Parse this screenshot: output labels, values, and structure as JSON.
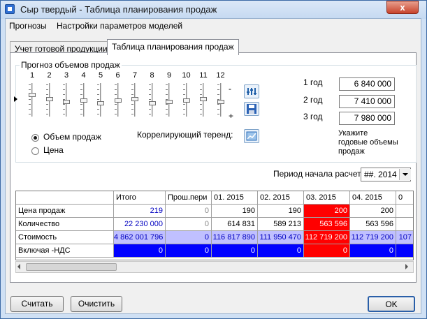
{
  "window": {
    "title": "Сыр твердый - Таблица планирования продаж",
    "close_glyph": "x"
  },
  "menu": [
    "Прогнозы",
    "Настройки параметров моделей"
  ],
  "tabs": [
    {
      "label": "Учет готовой продукции",
      "active": false
    },
    {
      "label": "Таблица планирования продаж",
      "active": true
    }
  ],
  "forecast": {
    "group_title": "Прогноз объемов продаж",
    "months": [
      "1",
      "2",
      "3",
      "4",
      "5",
      "6",
      "7",
      "8",
      "9",
      "10",
      "11",
      "12"
    ],
    "minus_sign": "-",
    "plus_sign": "+",
    "volume_label": "Объем продаж",
    "price_label": "Цена",
    "selected_mode": "Объем продаж",
    "correlation_label": "Коррелирующий теренд:",
    "years": [
      {
        "label": "1 год",
        "value": "6 840 000"
      },
      {
        "label": "2 год",
        "value": "7 410 000"
      },
      {
        "label": "3 год",
        "value": "7 980 000"
      }
    ],
    "hint": "Укажите\nгодовые объемы\nпродаж"
  },
  "period": {
    "label": "Период начала расчета",
    "value": "##. 2014"
  },
  "grid": {
    "columns": [
      "",
      "Итого",
      "Прош.пери",
      "01. 2015",
      "02. 2015",
      "03. 2015",
      "04. 2015",
      "0"
    ],
    "rows": [
      {
        "label": "Цена продаж",
        "cells": [
          "219",
          "0",
          "190",
          "190",
          "200",
          "200",
          ""
        ]
      },
      {
        "label": "Количество",
        "cells": [
          "22 230 000",
          "0",
          "614 831",
          "589 213",
          "563 596",
          "563 596",
          ""
        ]
      },
      {
        "label": "Стоимость",
        "cells": [
          "4 862 001 796",
          "0",
          "116 817 890",
          "111 950 470",
          "112 719 200",
          "112 719 200",
          "107"
        ]
      },
      {
        "label": "Включая -НДС",
        "cells": [
          "0",
          "0",
          "0",
          "0",
          "0",
          "0",
          ""
        ]
      }
    ]
  },
  "buttons": {
    "calc": "Считать",
    "clear": "Очистить",
    "ok": "OK"
  },
  "colors": {
    "highlight_red": "#ff0000",
    "blue_row": "#0000ff",
    "lavender": "#c0c0ff",
    "accent_text": "#0000c0"
  }
}
